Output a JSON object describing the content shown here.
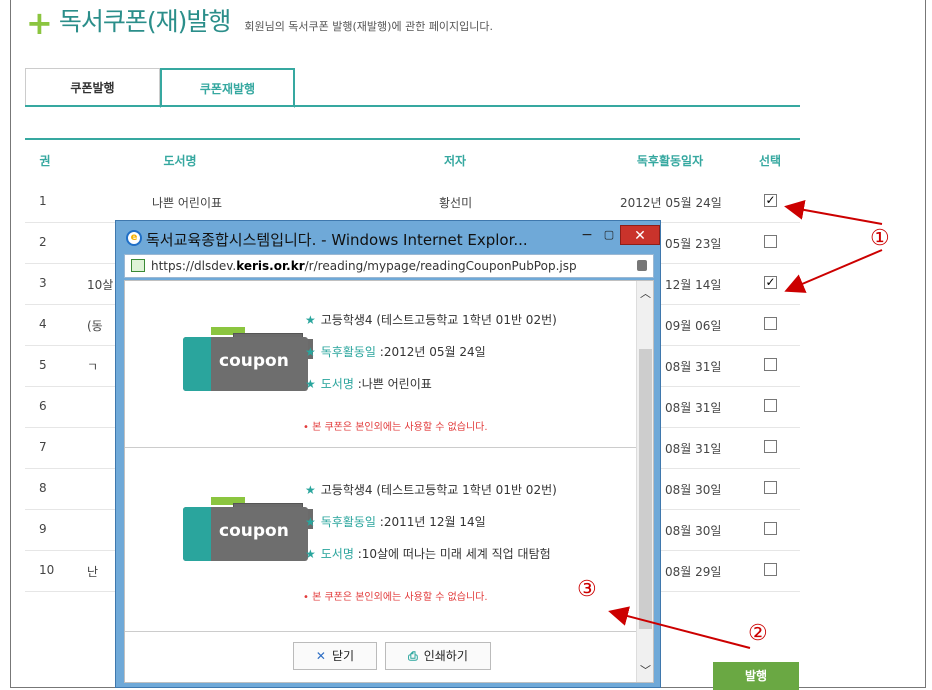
{
  "header": {
    "title": "독서쿠폰(재)발행",
    "subtitle": "회원님의 독서쿠폰 발행(재발행)에 관한 페이지입니다."
  },
  "tabs": [
    {
      "label": "쿠폰발행",
      "active": false
    },
    {
      "label": "쿠폰재발행",
      "active": true
    }
  ],
  "table": {
    "columns": [
      "권",
      "도서명",
      "저자",
      "독후활동일자",
      "선택"
    ],
    "rows": [
      {
        "no": "1",
        "title": "나쁜 어린이표",
        "author": "황선미",
        "date": "2012년 05월 24일",
        "checked": true
      },
      {
        "no": "2",
        "title": "",
        "author": "",
        "date": "05월 23일",
        "checked": false
      },
      {
        "no": "3",
        "title": "10살",
        "author": "",
        "date": "12월 14일",
        "checked": true
      },
      {
        "no": "4",
        "title": "(동",
        "author": "",
        "date": "09월 06일",
        "checked": false
      },
      {
        "no": "5",
        "title": "ㄱ",
        "author": "",
        "date": "08월 31일",
        "checked": false
      },
      {
        "no": "6",
        "title": "",
        "author": "",
        "date": "08월 31일",
        "checked": false
      },
      {
        "no": "7",
        "title": "",
        "author": "",
        "date": "08월 31일",
        "checked": false
      },
      {
        "no": "8",
        "title": "",
        "author": "",
        "date": "08월 30일",
        "checked": false
      },
      {
        "no": "9",
        "title": "",
        "author": "",
        "date": "08월 30일",
        "checked": false
      },
      {
        "no": "10",
        "title": "난",
        "author": "",
        "date": "08월 29일",
        "checked": false
      }
    ]
  },
  "issue_button": "발행",
  "popup": {
    "title": "독서교육종합시스템입니다. - Windows Internet Explor...",
    "url_prefix": "https://dlsdev.",
    "url_domain": "keris.or.kr",
    "url_suffix": "/r/reading/mypage/readingCouponPubPop.jsp",
    "coupon_word": "coupon",
    "entries": [
      {
        "student": "고등학생4 (테스트고등학교 1학년 01반 02번)",
        "activity_label": "독후활동일",
        "activity_value": " :2012년 05월 24일",
        "book_label": "도서명",
        "book_value": " :나쁜 어린이표",
        "warning": "• 본 쿠폰은 본인외에는 사용할 수 없습니다."
      },
      {
        "student": "고등학생4 (테스트고등학교 1학년 01반 02번)",
        "activity_label": "독후활동일",
        "activity_value": " :2011년 12월 14일",
        "book_label": "도서명",
        "book_value": " :10살에 떠나는 미래 세계 직업 대탐험",
        "warning": "• 본 쿠폰은 본인외에는 사용할 수 없습니다."
      }
    ],
    "close_label": "닫기",
    "print_label": "인쇄하기",
    "close_icon": "✕",
    "print_icon": "⎙"
  },
  "annotations": [
    "①",
    "②",
    "③"
  ],
  "colors": {
    "accent": "#36a8a0",
    "green_button": "#6aa843",
    "annotation": "#cc0000",
    "warning": "#e23b3b"
  }
}
